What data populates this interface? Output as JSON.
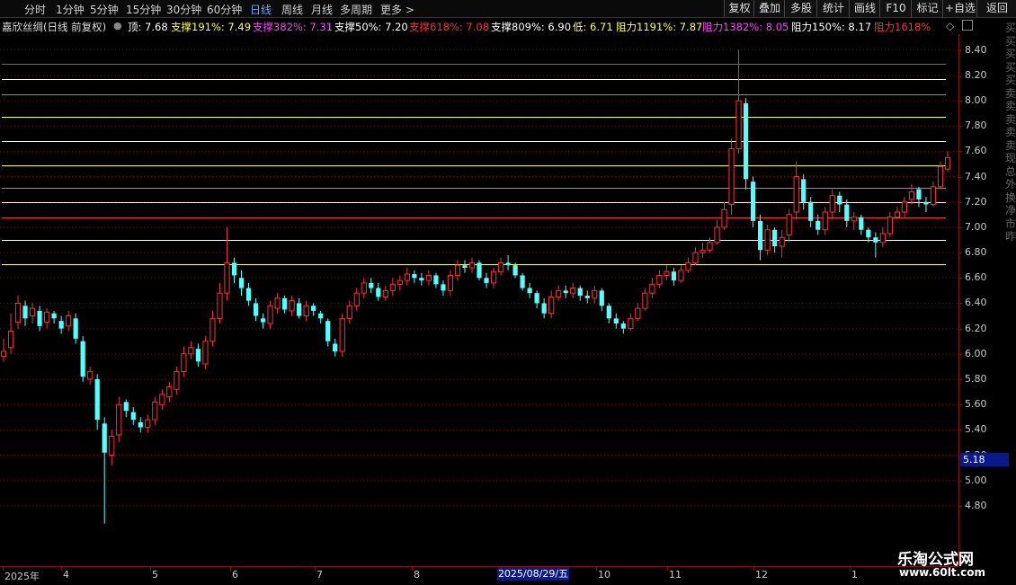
{
  "periods": [
    {
      "label": "分时",
      "active": false
    },
    {
      "label": "1分钟",
      "active": false
    },
    {
      "label": "5分钟",
      "active": false
    },
    {
      "label": "15分钟",
      "active": false
    },
    {
      "label": "30分钟",
      "active": false
    },
    {
      "label": "60分钟",
      "active": false
    },
    {
      "label": "日线",
      "active": true
    },
    {
      "label": "周线",
      "active": false
    },
    {
      "label": "月线",
      "active": false
    },
    {
      "label": "多周期",
      "active": false
    },
    {
      "label": "更多 >",
      "active": false
    }
  ],
  "tools": [
    "复权",
    "叠加",
    "多股",
    "统计",
    "画线",
    "F10",
    "标记",
    "+自选",
    "返回"
  ],
  "stock_title": "嘉欣丝绸(日线 前复权)",
  "legend": [
    {
      "text": "顶: 7.68",
      "color": "#ffffff"
    },
    {
      "text": "支撑191%: 7.49",
      "color": "#ffff40"
    },
    {
      "text": "支撑382%: 7.31",
      "color": "#ff40ff"
    },
    {
      "text": "支撑50%: 7.20",
      "color": "#ffffff"
    },
    {
      "text": "支撑618%: 7.08",
      "color": "#ff3030"
    },
    {
      "text": "支撑809%: 6.90",
      "color": "#ffffff"
    },
    {
      "text": "低: 6.71",
      "color": "#ffff40"
    },
    {
      "text": "阻力1191%: 7.87",
      "color": "#ffff40"
    },
    {
      "text": "阻力1382%: 8.05",
      "color": "#ff40ff"
    },
    {
      "text": "阻力150%: 8.17",
      "color": "#ffffff"
    },
    {
      "text": "阻力1618%",
      "color": "#ff3030"
    }
  ],
  "collapse_icon": "diamond-icon",
  "price_box": "5.18",
  "date_box": "2025/08/29/五",
  "side_text": "买买买买买卖卖卖卖卖现总外换净市昨",
  "watermark": {
    "line1": "乐淘公式网",
    "line2": "www.60lt.com"
  },
  "colors": {
    "up": "#ff3030",
    "down": "#54ffff",
    "grid": "#7a0a0a"
  },
  "chart_data": {
    "type": "candlestick",
    "y_ticks": [
      "8.40",
      "8.20",
      "8.00",
      "7.80",
      "7.60",
      "7.40",
      "7.20",
      "7.00",
      "6.80",
      "6.60",
      "6.40",
      "6.20",
      "6.00",
      "5.80",
      "5.60",
      "5.40",
      "5.20",
      "5.00",
      "4.80"
    ],
    "ylim": [
      4.65,
      8.5
    ],
    "x_labels": [
      "2025年",
      "4",
      "5",
      "6",
      "7",
      "8",
      "10",
      "11",
      "12",
      "1"
    ],
    "levels": [
      {
        "value": 8.29,
        "color": "#ff3030"
      },
      {
        "value": 8.17,
        "color": "#ffffff"
      },
      {
        "value": 8.05,
        "color": "#ff40ff"
      },
      {
        "value": 7.87,
        "color": "#ffff40"
      },
      {
        "value": 7.68,
        "color": "#ffffff"
      },
      {
        "value": 7.49,
        "color": "#ffff40"
      },
      {
        "value": 7.31,
        "color": "#ff40ff"
      },
      {
        "value": 7.2,
        "color": "#ffffff"
      },
      {
        "value": 7.08,
        "color": "#ff3030"
      },
      {
        "value": 6.9,
        "color": "#ffffff"
      },
      {
        "value": 6.71,
        "color": "#ffff40"
      }
    ],
    "closes": [
      6.02,
      6.18,
      6.4,
      6.28,
      6.36,
      6.22,
      6.33,
      6.28,
      6.2,
      6.3,
      6.12,
      5.82,
      5.86,
      5.48,
      5.22,
      5.35,
      5.6,
      5.55,
      5.48,
      5.42,
      5.48,
      5.62,
      5.68,
      5.74,
      5.86,
      6.0,
      6.05,
      5.94,
      6.1,
      6.28,
      6.48,
      6.72,
      6.62,
      6.52,
      6.42,
      6.3,
      6.25,
      6.38,
      6.44,
      6.35,
      6.42,
      6.3,
      6.38,
      6.34,
      6.28,
      6.1,
      6.02,
      6.28,
      6.38,
      6.48,
      6.56,
      6.52,
      6.45,
      6.5,
      6.55,
      6.58,
      6.63,
      6.6,
      6.58,
      6.62,
      6.55,
      6.5,
      6.62,
      6.7,
      6.68,
      6.72,
      6.6,
      6.56,
      6.65,
      6.72,
      6.7,
      6.62,
      6.52,
      6.48,
      6.4,
      6.32,
      6.45,
      6.5,
      6.48,
      6.52,
      6.46,
      6.44,
      6.5,
      6.38,
      6.28,
      6.24,
      6.2,
      6.28,
      6.36,
      6.48,
      6.55,
      6.62,
      6.65,
      6.58,
      6.66,
      6.72,
      6.8,
      6.82,
      6.88,
      7.0,
      7.14,
      7.62,
      8.0,
      7.38,
      7.05,
      6.82,
      6.98,
      6.85,
      6.92,
      7.1,
      7.4,
      7.2,
      7.05,
      6.98,
      7.12,
      7.25,
      7.18,
      7.05,
      7.08,
      6.98,
      6.92,
      6.88,
      6.95,
      7.08,
      7.12,
      7.2,
      7.28,
      7.22,
      7.18,
      7.32,
      7.48,
      7.55
    ],
    "opens": [
      5.98,
      6.05,
      6.25,
      6.38,
      6.3,
      6.34,
      6.25,
      6.32,
      6.26,
      6.22,
      6.28,
      6.1,
      5.8,
      5.8,
      5.45,
      5.2,
      5.36,
      5.62,
      5.54,
      5.46,
      5.42,
      5.48,
      5.6,
      5.66,
      5.72,
      5.86,
      6.0,
      6.04,
      5.92,
      6.1,
      6.28,
      6.48,
      6.72,
      6.6,
      6.52,
      6.4,
      6.28,
      6.24,
      6.36,
      6.44,
      6.34,
      6.4,
      6.3,
      6.38,
      6.32,
      6.26,
      6.08,
      6.02,
      6.28,
      6.38,
      6.48,
      6.56,
      6.52,
      6.45,
      6.5,
      6.55,
      6.58,
      6.63,
      6.6,
      6.58,
      6.62,
      6.55,
      6.5,
      6.62,
      6.7,
      6.68,
      6.72,
      6.6,
      6.56,
      6.65,
      6.72,
      6.7,
      6.62,
      6.52,
      6.48,
      6.4,
      6.32,
      6.45,
      6.5,
      6.48,
      6.52,
      6.46,
      6.44,
      6.5,
      6.38,
      6.28,
      6.24,
      6.2,
      6.28,
      6.36,
      6.48,
      6.55,
      6.62,
      6.65,
      6.58,
      6.66,
      6.72,
      6.8,
      6.82,
      6.88,
      7.0,
      7.18,
      7.62,
      7.98,
      7.36,
      7.05,
      6.82,
      6.98,
      6.85,
      6.94,
      7.12,
      7.38,
      7.2,
      7.05,
      6.98,
      7.12,
      7.25,
      7.18,
      7.05,
      7.08,
      6.98,
      6.92,
      6.88,
      6.95,
      7.08,
      7.12,
      7.22,
      7.3,
      7.2,
      7.18,
      7.32,
      7.46
    ],
    "highs": [
      6.12,
      6.32,
      6.46,
      6.42,
      6.4,
      6.38,
      6.36,
      6.34,
      6.3,
      6.34,
      6.32,
      6.14,
      5.9,
      5.84,
      5.5,
      5.4,
      5.66,
      5.64,
      5.58,
      5.5,
      5.52,
      5.66,
      5.72,
      5.78,
      5.9,
      6.06,
      6.1,
      6.08,
      6.14,
      6.34,
      6.56,
      7.0,
      6.76,
      6.66,
      6.56,
      6.44,
      6.32,
      6.42,
      6.48,
      6.46,
      6.46,
      6.44,
      6.42,
      6.4,
      6.34,
      6.28,
      6.12,
      6.32,
      6.42,
      6.52,
      6.6,
      6.6,
      6.56,
      6.54,
      6.6,
      6.62,
      6.68,
      6.66,
      6.64,
      6.66,
      6.64,
      6.58,
      6.66,
      6.74,
      6.74,
      6.76,
      6.74,
      6.64,
      6.68,
      6.76,
      6.78,
      6.72,
      6.64,
      6.56,
      6.5,
      6.44,
      6.5,
      6.54,
      6.54,
      6.56,
      6.54,
      6.5,
      6.54,
      6.52,
      6.4,
      6.32,
      6.26,
      6.32,
      6.4,
      6.52,
      6.6,
      6.66,
      6.7,
      6.68,
      6.7,
      6.76,
      6.84,
      6.88,
      6.92,
      7.06,
      7.2,
      7.7,
      8.4,
      8.02,
      7.4,
      7.1,
      7.02,
      7.0,
      6.98,
      7.14,
      7.52,
      7.42,
      7.24,
      7.1,
      7.16,
      7.3,
      7.28,
      7.22,
      7.12,
      7.1,
      7.0,
      6.96,
      7.0,
      7.12,
      7.16,
      7.24,
      7.34,
      7.32,
      7.24,
      7.36,
      7.52,
      7.6
    ],
    "lows": [
      5.94,
      6.0,
      6.2,
      6.22,
      6.24,
      6.18,
      6.2,
      6.24,
      6.16,
      6.18,
      6.08,
      5.78,
      5.76,
      5.4,
      4.66,
      5.12,
      5.3,
      5.5,
      5.44,
      5.38,
      5.38,
      5.44,
      5.56,
      5.62,
      5.68,
      5.82,
      5.96,
      5.9,
      5.88,
      6.06,
      6.24,
      6.42,
      6.56,
      6.46,
      6.38,
      6.26,
      6.2,
      6.2,
      6.32,
      6.32,
      6.3,
      6.28,
      6.26,
      6.3,
      6.24,
      6.06,
      5.98,
      5.98,
      6.24,
      6.34,
      6.44,
      6.48,
      6.42,
      6.42,
      6.46,
      6.5,
      6.54,
      6.56,
      6.54,
      6.54,
      6.52,
      6.46,
      6.46,
      6.58,
      6.64,
      6.64,
      6.58,
      6.52,
      6.52,
      6.62,
      6.66,
      6.6,
      6.5,
      6.44,
      6.36,
      6.28,
      6.28,
      6.42,
      6.44,
      6.44,
      6.42,
      6.4,
      6.4,
      6.34,
      6.24,
      6.2,
      6.16,
      6.18,
      6.26,
      6.34,
      6.44,
      6.52,
      6.58,
      6.54,
      6.56,
      6.64,
      6.7,
      6.76,
      6.8,
      6.86,
      6.98,
      7.1,
      7.58,
      7.3,
      7.0,
      6.74,
      6.78,
      6.8,
      6.76,
      6.88,
      7.06,
      7.14,
      7.0,
      6.94,
      6.94,
      7.06,
      7.12,
      7.0,
      6.98,
      6.94,
      6.88,
      6.76,
      6.84,
      6.92,
      7.06,
      7.08,
      7.18,
      7.16,
      7.12,
      7.16,
      7.3,
      7.44
    ]
  }
}
